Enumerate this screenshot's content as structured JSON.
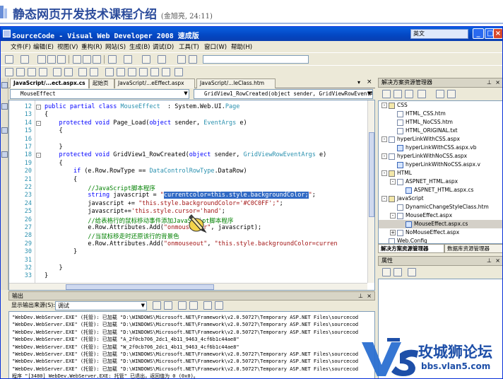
{
  "slide": {
    "title": "静态网页开发技术课程介绍",
    "subtitle": "(金旭亮, 24:11)"
  },
  "window": {
    "title": "SourceCode - Visual Web Developer 2008 速成版",
    "ime": "英文",
    "menu": [
      "文件(F)",
      "编辑(E)",
      "视图(V)",
      "重构(R)",
      "网站(S)",
      "生成(B)",
      "调试(D)",
      "工具(T)",
      "窗口(W)",
      "帮助(H)"
    ]
  },
  "doc_tabs": [
    {
      "label": "JavaScript/...ect.aspx.cs",
      "active": true
    },
    {
      "label": "起始页",
      "active": false
    },
    {
      "label": "JavaScript/...eEffect.aspx",
      "active": false
    },
    {
      "label": "JavaScript/...leClass.htm",
      "active": false
    }
  ],
  "editor": {
    "class_dropdown": "MouseEffect",
    "member_dropdown": "GridView1_RowCreated(object sender, GridViewRowEventAr",
    "lines": [
      {
        "n": "12",
        "parts": [
          [
            "kw",
            "public partial class "
          ],
          [
            "ty",
            "MouseEffect"
          ],
          [
            "",
            "  : System.Web.UI."
          ],
          [
            "ty",
            "Page"
          ]
        ]
      },
      {
        "n": "13",
        "parts": [
          [
            "",
            "{"
          ]
        ]
      },
      {
        "n": "14",
        "parts": [
          [
            "",
            "    "
          ],
          [
            "kw",
            "protected void "
          ],
          [
            "",
            "Page_Load("
          ],
          [
            "kw",
            "object "
          ],
          [
            "",
            "sender, "
          ],
          [
            "ty",
            "EventArgs "
          ],
          [
            "",
            "e)"
          ]
        ]
      },
      {
        "n": "15",
        "parts": [
          [
            "",
            "    {"
          ]
        ]
      },
      {
        "n": "16",
        "parts": [
          [
            "",
            ""
          ]
        ]
      },
      {
        "n": "17",
        "parts": [
          [
            "",
            "    }"
          ]
        ]
      },
      {
        "n": "18",
        "parts": [
          [
            "",
            "    "
          ],
          [
            "kw",
            "protected void "
          ],
          [
            "",
            "GridView1_RowCreated("
          ],
          [
            "kw",
            "object "
          ],
          [
            "",
            "sender, "
          ],
          [
            "ty",
            "GridViewRowEventArgs "
          ],
          [
            "",
            "e)"
          ]
        ]
      },
      {
        "n": "19",
        "parts": [
          [
            "",
            "    {"
          ]
        ]
      },
      {
        "n": "20",
        "parts": [
          [
            "",
            "        "
          ],
          [
            "kw",
            "if "
          ],
          [
            "",
            "(e.Row.RowType == "
          ],
          [
            "ty",
            "DataControlRowType"
          ],
          [
            "",
            ".DataRow)"
          ]
        ]
      },
      {
        "n": "21",
        "parts": [
          [
            "",
            "        {"
          ]
        ]
      },
      {
        "n": "22",
        "parts": [
          [
            "",
            "            "
          ],
          [
            "cm",
            "//JavaScript脚本程序"
          ]
        ]
      },
      {
        "n": "23",
        "parts": [
          [
            "",
            "            "
          ],
          [
            "kw",
            "string "
          ],
          [
            "",
            "javascript = "
          ],
          [
            "st",
            "\""
          ],
          [
            "sel",
            "currentcolor=this.style.backgroundColor;"
          ],
          [
            "st",
            "\""
          ],
          [
            "",
            ";"
          ]
        ]
      },
      {
        "n": "24",
        "parts": [
          [
            "",
            "            javascript += "
          ],
          [
            "st",
            "\"this.style.backgroundColor='#C0C0FF';\""
          ],
          [
            "",
            ";"
          ]
        ]
      },
      {
        "n": "25",
        "parts": [
          [
            "",
            "            javascript+="
          ],
          [
            "st",
            "'this.style.cursor='hand'"
          ],
          [
            "",
            ";"
          ]
        ]
      },
      {
        "n": "26",
        "parts": [
          [
            "",
            "            "
          ],
          [
            "cm",
            "//给表格行的鼠标移动事件添加JavaScript脚本程序"
          ]
        ]
      },
      {
        "n": "27",
        "parts": [
          [
            "",
            "            e.Row.Attributes.Add("
          ],
          [
            "st",
            "\"onmouseover\""
          ],
          [
            "",
            ", javascript);"
          ]
        ]
      },
      {
        "n": "28",
        "parts": [
          [
            "",
            "            "
          ],
          [
            "cm",
            "//当鼠标移走时还原该行的背景色"
          ]
        ]
      },
      {
        "n": "29",
        "parts": [
          [
            "",
            "            e.Row.Attributes.Add("
          ],
          [
            "st",
            "\"onmouseout\""
          ],
          [
            "",
            ", "
          ],
          [
            "st",
            "\"this.style.backgroundColor=curren"
          ]
        ]
      },
      {
        "n": "30",
        "parts": [
          [
            "",
            "        }"
          ]
        ]
      },
      {
        "n": "31",
        "parts": [
          [
            "",
            ""
          ]
        ]
      },
      {
        "n": "32",
        "parts": [
          [
            "",
            "    }"
          ]
        ]
      },
      {
        "n": "33",
        "parts": [
          [
            "",
            "}"
          ]
        ]
      }
    ]
  },
  "solution_explorer": {
    "title": "解决方案资源管理器",
    "items": [
      {
        "label": "CSS",
        "indent": 0,
        "kind": "folder",
        "exp": "-"
      },
      {
        "label": "HTML_CSS.htm",
        "indent": 1,
        "kind": "file"
      },
      {
        "label": "HTML_NoCSS.htm",
        "indent": 1,
        "kind": "file"
      },
      {
        "label": "HTML_ORIGINAL.txt",
        "indent": 1,
        "kind": "file"
      },
      {
        "label": "hyperLinkWithCSS.aspx",
        "indent": 0,
        "kind": "file",
        "exp": "-"
      },
      {
        "label": "hyperLinkWithCSS.aspx.vb",
        "indent": 1,
        "kind": "cs"
      },
      {
        "label": "hyperLinkWithNoCSS.aspx",
        "indent": 0,
        "kind": "file",
        "exp": "-"
      },
      {
        "label": "hyperLinkWithNoCSS.aspx.v",
        "indent": 1,
        "kind": "cs"
      },
      {
        "label": "HTML",
        "indent": 0,
        "kind": "folder",
        "exp": "-"
      },
      {
        "label": "ASPNET_HTML.aspx",
        "indent": 1,
        "kind": "file",
        "exp": "-"
      },
      {
        "label": "ASPNET_HTML.aspx.cs",
        "indent": 2,
        "kind": "cs"
      },
      {
        "label": "JavaScript",
        "indent": 0,
        "kind": "folder",
        "exp": "-"
      },
      {
        "label": "DynamicChangeStyleClass.htm",
        "indent": 1,
        "kind": "file"
      },
      {
        "label": "MouseEffect.aspx",
        "indent": 1,
        "kind": "file",
        "exp": "-"
      },
      {
        "label": "MouseEffect.aspx.cs",
        "indent": 2,
        "kind": "cs",
        "hl": true
      },
      {
        "label": "NoMouseEffect.aspx",
        "indent": 1,
        "kind": "file",
        "exp": "+"
      },
      {
        "label": "Web.Config",
        "indent": 0,
        "kind": "file"
      }
    ],
    "tabs": [
      "解决方案资源管理器",
      "数据库资源管理器"
    ]
  },
  "properties": {
    "title": "属性"
  },
  "output": {
    "title": "输出",
    "source_label": "显示输出来源(S):",
    "source_value": "调试",
    "lines": [
      "\"WebDev.WebServer.EXE\" (托管): 已加载 \"D:\\WINDOWS\\Microsoft.NET\\Framework\\v2.0.50727\\Temporary ASP.NET Files\\sourcecod",
      "\"WebDev.WebServer.EXE\" (托管): 已加载 \"D:\\WINDOWS\\Microsoft.NET\\Framework\\v2.0.50727\\Temporary ASP.NET Files\\sourcecod",
      "\"WebDev.WebServer.EXE\" (托管): 已加载 \"D:\\WINDOWS\\Microsoft.NET\\Framework\\v2.0.50727\\Temporary ASP.NET Files\\sourcecod",
      "\"WebDev.WebServer.EXE\" (托管): 已加载 \"A_2f0cb706_2dc1_4b11_9463_4cf6b1c44ae8\"",
      "\"WebDev.WebServer.EXE\" (托管): 已加载 \"W_2f0cb706_2dc1_4b11_9463_4cf6b1c44ae8\"",
      "\"WebDev.WebServer.EXE\" (托管): 已加载 \"D:\\WINDOWS\\Microsoft.NET\\Framework\\v2.0.50727\\Temporary ASP.NET Files\\sourcecod",
      "\"WebDev.WebServer.EXE\" (托管): 已加载 \"D:\\WINDOWS\\Microsoft.NET\\Framework\\v2.0.50727\\Temporary ASP.NET Files\\sourcecod",
      "\"WebDev.WebServer.EXE\" (托管): 已加载 \"D:\\WINDOWS\\Microsoft.NET\\Framework\\v2.0.50727\\Temporary ASP.NET Files\\sourcecod",
      "程序 \"[3480] WebDev.WebServer.EXE: 托管\" 已退出，返回值为 0 (0x0)。"
    ]
  },
  "watermark": {
    "name": "玫城狮论坛",
    "url": "bbs.vlan5.com",
    "mark": "V5"
  },
  "colors": {
    "accent": "#0a5fe0",
    "slide_title": "#2b4b9b",
    "watermark": "#1e4fa8"
  }
}
